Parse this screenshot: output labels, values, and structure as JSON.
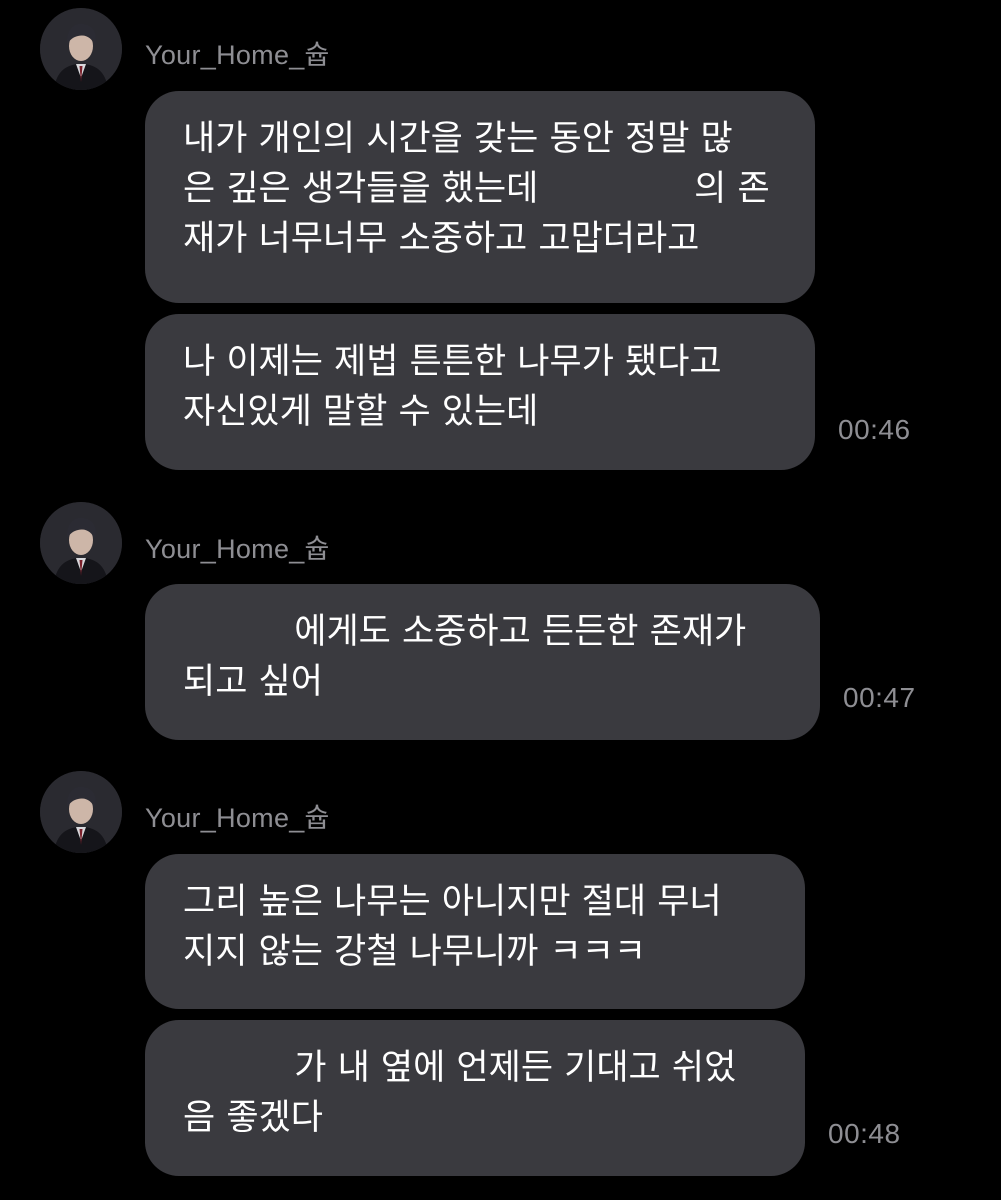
{
  "chat": {
    "groups": [
      {
        "sender": "Your_Home_슙",
        "messages": [
          {
            "lines": [
              "내가 개인의 시간을 갖는 동안 정말 많",
              "은 깊은 생각들을 했는데              의 존",
              "재가 너무너무 소중하고 고맙더라고"
            ]
          },
          {
            "lines": [
              "나 이제는 제법 튼튼한 나무가 됐다고",
              "자신있게 말할 수 있는데"
            ],
            "time": "00:46"
          }
        ]
      },
      {
        "sender": "Your_Home_슙",
        "messages": [
          {
            "lines": [
              "          에게도 소중하고 든든한 존재가",
              "되고 싶어"
            ],
            "time": "00:47"
          }
        ]
      },
      {
        "sender": "Your_Home_슙",
        "messages": [
          {
            "lines": [
              "그리 높은 나무는 아니지만 절대 무너",
              "지지 않는 강철 나무니까 ㅋㅋㅋ"
            ]
          },
          {
            "lines": [
              "          가 내 옆에 언제든 기대고 쉬었",
              "음 좋겠다"
            ],
            "time": "00:48"
          }
        ]
      }
    ]
  }
}
